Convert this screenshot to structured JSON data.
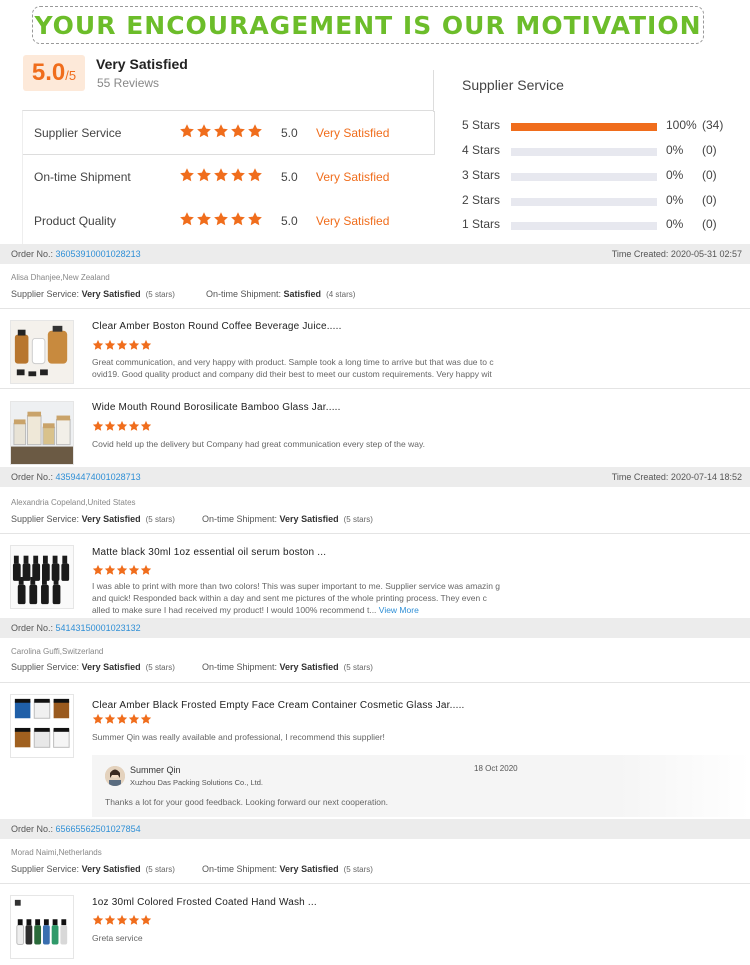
{
  "banner": "YOUR ENCOURAGEMENT IS OUR MOTIVATION",
  "summary": {
    "score": "5.0",
    "score_max": "/5",
    "title": "Very Satisfied",
    "reviews": "55 Reviews",
    "metrics": [
      {
        "name": "Supplier Service",
        "value": "5.0",
        "label": "Very Satisfied",
        "stars": 5
      },
      {
        "name": "On-time Shipment",
        "value": "5.0",
        "label": "Very Satisfied",
        "stars": 5
      },
      {
        "name": "Product Quality",
        "value": "5.0",
        "label": "Very Satisfied",
        "stars": 5
      }
    ]
  },
  "distribution": {
    "title": "Supplier Service",
    "rows": [
      {
        "label": "5 Stars",
        "percent": "100%",
        "count": "(34)",
        "fill": 1.0
      },
      {
        "label": "4 Stars",
        "percent": "0%",
        "count": "(0)",
        "fill": 0
      },
      {
        "label": "3 Stars",
        "percent": "0%",
        "count": "(0)",
        "fill": 0
      },
      {
        "label": "2 Stars",
        "percent": "0%",
        "count": "(0)",
        "fill": 0
      },
      {
        "label": "1 Stars",
        "percent": "0%",
        "count": "(0)",
        "fill": 0
      }
    ]
  },
  "orders": [
    {
      "order_label": "Order No.:",
      "order_no": "36053910001028213",
      "time": "Time Created: 2020-05-31 02:57",
      "reviewer": "Alisa Dhanjee,New Zealand",
      "service_label": "Supplier Service:",
      "service_value": "Very Satisfied",
      "service_stars": "(5 stars)",
      "shipment_label": "On-time Shipment:",
      "shipment_value": "Satisfied",
      "shipment_stars": "(4 stars)",
      "products": [
        {
          "title": "Clear Amber Boston Round Coffee Beverage Juice.....",
          "stars": 5,
          "text": "Great communication, and very happy with product. Sample took a long time to arrive but that was due to c ovid19. Good quality product and company did their best to meet our custom requirements. Very happy wit"
        },
        {
          "title": "Wide Mouth Round Borosilicate Bamboo Glass Jar.....",
          "stars": 5,
          "text": "Covid held up the delivery but Company had great communication every step of the way."
        }
      ]
    },
    {
      "order_label": "Order No.:",
      "order_no": "43594474001028713",
      "time": "Time Created: 2020-07-14 18:52",
      "reviewer": "Alexandria Copeland,United States",
      "service_label": "Supplier Service:",
      "service_value": "Very Satisfied",
      "service_stars": "(5 stars)",
      "shipment_label": "On-time Shipment:",
      "shipment_value": "Very Satisfied",
      "shipment_stars": "(5 stars)",
      "products": [
        {
          "title": "Matte black 30ml 1oz essential oil serum boston ...",
          "stars": 5,
          "text": "I was able to print with more than two colors! This was super important to me. Supplier service was amazin g and quick! Responded back within a day and sent me pictures of the whole printing process. They even c alled to make sure I had received my product! I would 100% recommend t...",
          "view_more": "View More"
        }
      ]
    },
    {
      "order_label": "Order No.:",
      "order_no": "54143150001023132",
      "time": "",
      "reviewer": "Carolina Guffi,Switzerland",
      "service_label": "Supplier Service:",
      "service_value": "Very Satisfied",
      "service_stars": "(5 stars)",
      "shipment_label": "On-time Shipment:",
      "shipment_value": "Very Satisfied",
      "shipment_stars": "(5 stars)",
      "products": [
        {
          "title": "Clear Amber Black Frosted Empty Face Cream Container Cosmetic Glass Jar.....",
          "stars": 5,
          "text": "Summer Qin was really available and professional, I recommend this supplier!"
        }
      ],
      "reply": {
        "name": "Summer Qin",
        "company": "Xuzhou Das Packing Solutions Co., Ltd.",
        "date": "18 Oct 2020",
        "text": "Thanks a lot for your good feedback. Looking forward our next cooperation."
      }
    },
    {
      "order_label": "Order No.:",
      "order_no": "65665562501027854",
      "time": "",
      "reviewer": "Morad Naimi,Netherlands",
      "service_label": "Supplier Service:",
      "service_value": "Very Satisfied",
      "service_stars": "(5 stars)",
      "shipment_label": "On-time Shipment:",
      "shipment_value": "Very Satisfied",
      "shipment_stars": "(5 stars)",
      "products": [
        {
          "title": "1oz 30ml Colored Frosted Coated Hand Wash ...",
          "stars": 5,
          "text": "Greta service"
        }
      ]
    }
  ],
  "colors": {
    "accent": "#f06d1c",
    "banner": "#6cbd2a",
    "link": "#2f8fd6"
  }
}
